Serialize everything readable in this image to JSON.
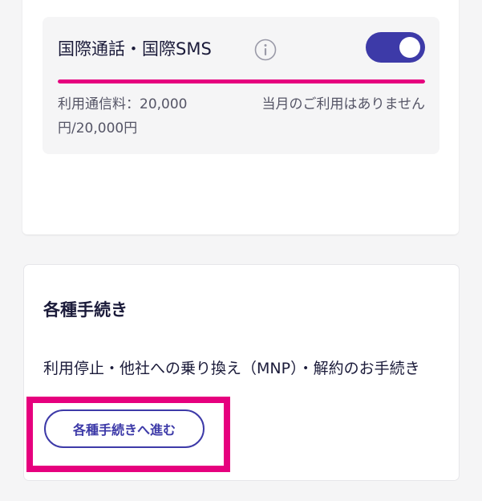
{
  "usage_card": {
    "title": "国際通話・国際SMS",
    "info_icon": "info-icon",
    "toggle_on": true,
    "toggle_color": "#3d3aa8",
    "progress_color": "#e6007e",
    "progress_fraction": 1.0,
    "usage_left": "利用通信料：20,000円/20,000円",
    "usage_right": "当月のご利用はありません"
  },
  "procedures": {
    "title": "各種手続き",
    "description": "利用停止・他社への乗り換え（MNP）・解約のお手続き",
    "button_label": "各種手続きへ進む",
    "highlight_color": "#e6007e"
  }
}
